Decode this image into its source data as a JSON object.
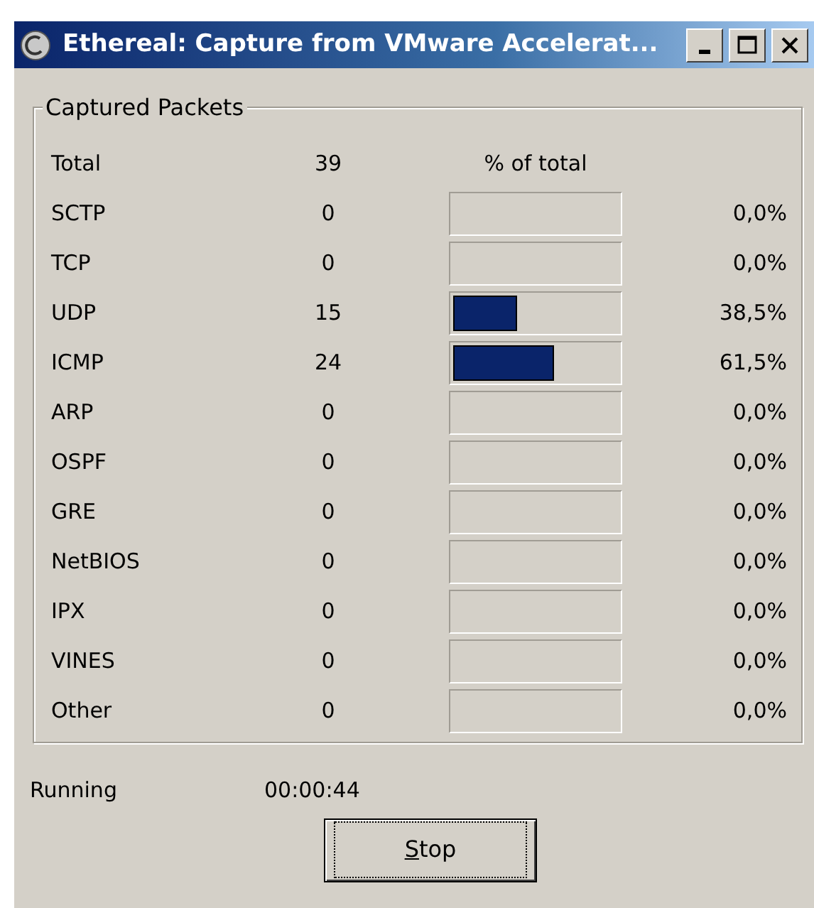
{
  "window": {
    "title": "Ethereal: Capture from VMware Accelerat..."
  },
  "group": {
    "title": "Captured Packets",
    "header": {
      "name": "Total",
      "count": "39",
      "column": "% of total"
    },
    "rows": [
      {
        "name": "SCTP",
        "count": "0",
        "percent": "0,0%"
      },
      {
        "name": "TCP",
        "count": "0",
        "percent": "0,0%"
      },
      {
        "name": "UDP",
        "count": "15",
        "level": 0.385,
        "percent": "38,5%"
      },
      {
        "name": "ICMP",
        "count": "24",
        "level": 0.615,
        "percent": "61,5%"
      },
      {
        "name": "ARP",
        "count": "0",
        "percent": "0,0%"
      },
      {
        "name": "OSPF",
        "count": "0",
        "percent": "0,0%"
      },
      {
        "name": "GRE",
        "count": "0",
        "percent": "0,0%"
      },
      {
        "name": "NetBIOS",
        "count": "0",
        "percent": "0,0%"
      },
      {
        "name": "IPX",
        "count": "0",
        "percent": "0,0%"
      },
      {
        "name": "VINES",
        "count": "0",
        "percent": "0,0%"
      },
      {
        "name": "Other",
        "count": "0",
        "percent": "0,0%"
      }
    ]
  },
  "status": {
    "label": "Running",
    "time": "00:00:44"
  },
  "buttons": [
    {
      "label": "Stop",
      "focused": true
    }
  ]
}
